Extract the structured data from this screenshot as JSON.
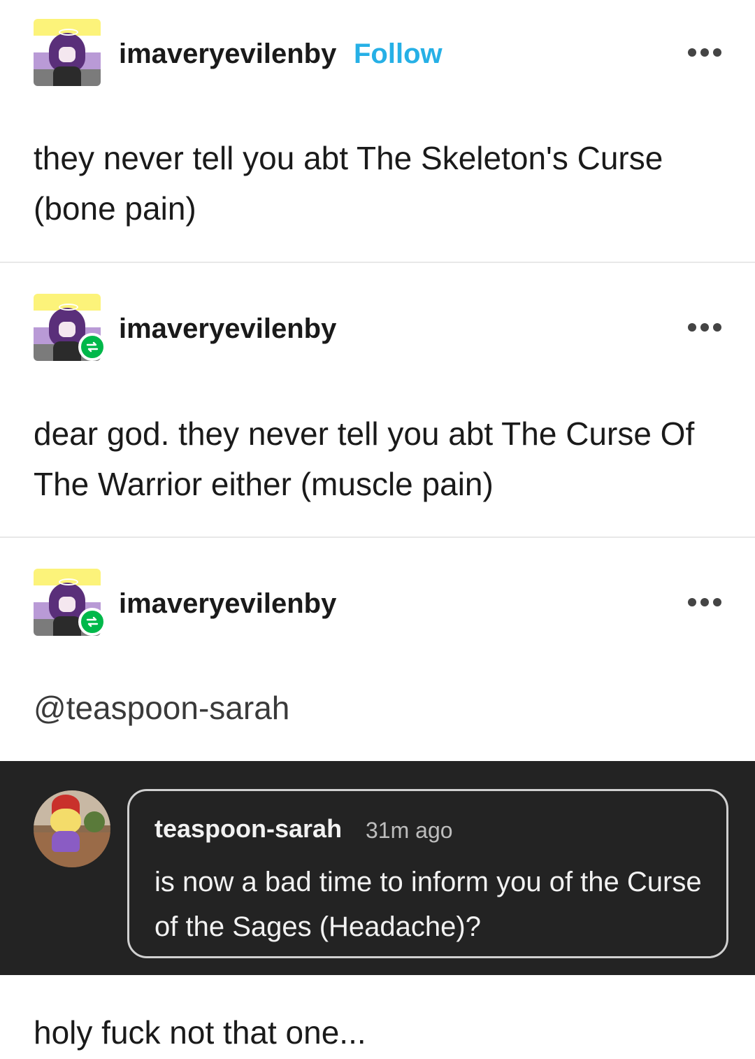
{
  "posts": [
    {
      "username": "imaveryevilenby",
      "follow_label": "Follow",
      "body": "they never tell you abt The Skeleton's Curse (bone pain)"
    },
    {
      "username": "imaveryevilenby",
      "body": "dear god. they never tell you abt The Curse Of The Warrior either (muscle pain)"
    },
    {
      "username": "imaveryevilenby",
      "mention": "@teaspoon-sarah"
    }
  ],
  "comment": {
    "username": "teaspoon-sarah",
    "time": "31m ago",
    "text": "is now a bad time to inform you of the Curse of the Sages (Headache)?"
  },
  "reply": "holy fuck not that one...",
  "colors": {
    "follow": "#26b0e6",
    "reblog_badge": "#00b84a",
    "dark_panel": "#232323"
  },
  "icons": {
    "more": "more-options-icon",
    "reblog": "reblog-icon"
  }
}
